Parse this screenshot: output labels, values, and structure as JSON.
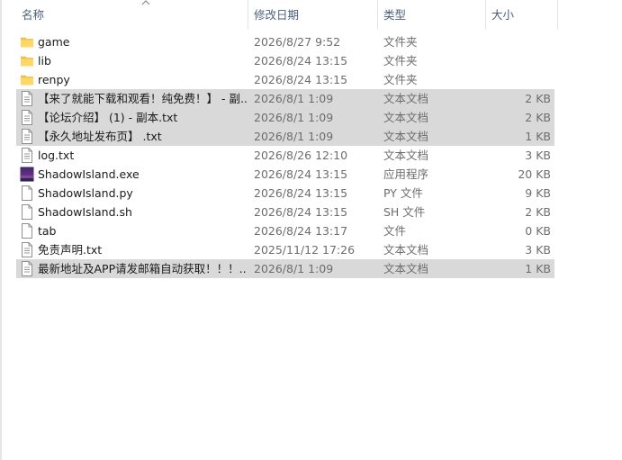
{
  "columns": {
    "name": "名称",
    "date": "修改日期",
    "type": "类型",
    "size": "大小"
  },
  "files": [
    {
      "name": "game",
      "date": "2026/8/27 9:52",
      "type": "文件夹",
      "size": "",
      "icon": "folder-icon",
      "selected": false
    },
    {
      "name": "lib",
      "date": "2026/8/24 13:15",
      "type": "文件夹",
      "size": "",
      "icon": "folder-icon",
      "selected": false
    },
    {
      "name": "renpy",
      "date": "2026/8/24 13:15",
      "type": "文件夹",
      "size": "",
      "icon": "folder-icon",
      "selected": false
    },
    {
      "name": "【来了就能下载和观看！纯免费！】 - 副...",
      "date": "2026/8/1 1:09",
      "type": "文本文档",
      "size": "2 KB",
      "icon": "text-file-icon",
      "selected": true
    },
    {
      "name": "【论坛介绍】 (1) - 副本.txt",
      "date": "2026/8/1 1:09",
      "type": "文本文档",
      "size": "2 KB",
      "icon": "text-file-icon",
      "selected": true
    },
    {
      "name": "【永久地址发布页】 .txt",
      "date": "2026/8/1 1:09",
      "type": "文本文档",
      "size": "1 KB",
      "icon": "text-file-icon",
      "selected": true
    },
    {
      "name": "log.txt",
      "date": "2026/8/26 12:10",
      "type": "文本文档",
      "size": "3 KB",
      "icon": "text-file-icon",
      "selected": false
    },
    {
      "name": "ShadowIsland.exe",
      "date": "2026/8/24 13:15",
      "type": "应用程序",
      "size": "20 KB",
      "icon": "exe-icon",
      "selected": false
    },
    {
      "name": "ShadowIsland.py",
      "date": "2026/8/24 13:15",
      "type": "PY 文件",
      "size": "9 KB",
      "icon": "blank-file-icon",
      "selected": false
    },
    {
      "name": "ShadowIsland.sh",
      "date": "2026/8/24 13:15",
      "type": "SH 文件",
      "size": "2 KB",
      "icon": "blank-file-icon",
      "selected": false
    },
    {
      "name": "tab",
      "date": "2026/8/24 13:17",
      "type": "文件",
      "size": "0 KB",
      "icon": "blank-file-icon",
      "selected": false
    },
    {
      "name": "免责声明.txt",
      "date": "2025/11/12 17:26",
      "type": "文本文档",
      "size": "3 KB",
      "icon": "text-file-icon",
      "selected": false
    },
    {
      "name": "最新地址及APP请发邮箱自动获取！！！...",
      "date": "2026/8/1 1:09",
      "type": "文本文档",
      "size": "1 KB",
      "icon": "text-file-icon",
      "selected": true
    }
  ],
  "colors": {
    "header_text": "#4c607a",
    "selected_row": "#d9d9d9",
    "folder": "#f6c445",
    "secondary_text": "#6d6d6d"
  }
}
